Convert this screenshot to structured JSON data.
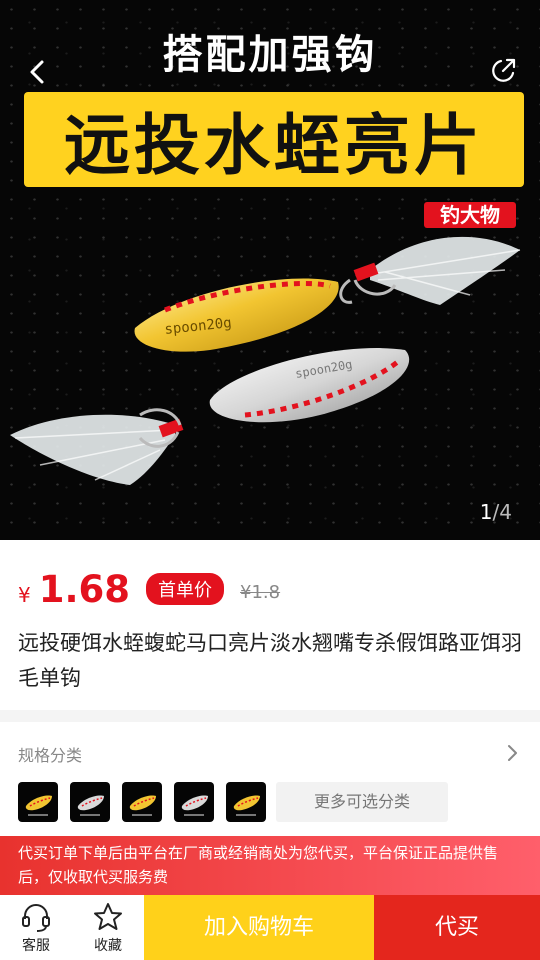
{
  "hero": {
    "top_title": "搭配加强钩",
    "banner_text": "远投水蛭亮片",
    "tag": "钓大物",
    "spoon_gold_text": "spoon20g",
    "spoon_silver_text": "spoon20g",
    "pager_current": "1",
    "pager_sep": "/",
    "pager_total": "4"
  },
  "price": {
    "currency": "¥",
    "value": "1.68",
    "badge": "首单价",
    "original": "¥1.8"
  },
  "product": {
    "title": "远投硬饵水蛭蝮蛇马口亮片淡水翘嘴专杀假饵路亚饵羽毛单钩"
  },
  "spec": {
    "label": "规格分类",
    "thumb_count": 5,
    "more_label": "更多可选分类"
  },
  "notice": {
    "text": "代买订单下单后由平台在厂商或经销商处为您代买，平台保证正品提供售后，仅收取代买服务费"
  },
  "bottom_bar": {
    "service_label": "客服",
    "favorite_label": "收藏",
    "cart_label": "加入购物车",
    "buy_label": "代买"
  },
  "colors": {
    "accent_red": "#e3121e",
    "cart_yellow": "#ffd11a",
    "buy_red": "#e4261d",
    "banner_yellow": "#ffd21f"
  },
  "icons": [
    "back-icon",
    "share-icon",
    "chevron-right-icon",
    "headset-icon",
    "star-icon"
  ]
}
